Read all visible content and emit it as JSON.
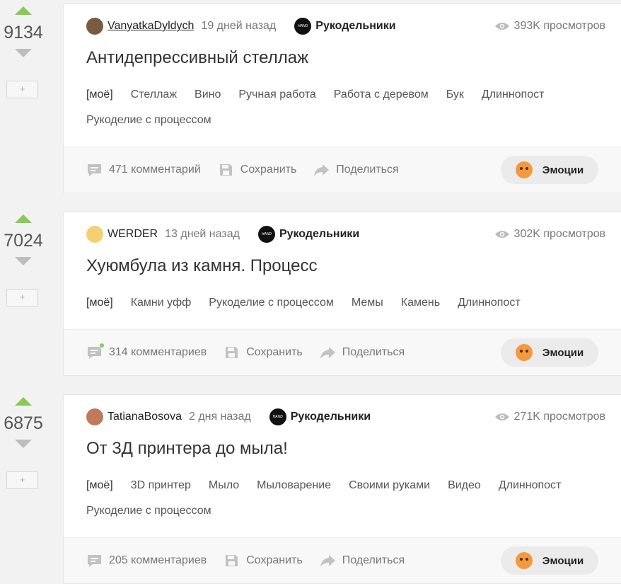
{
  "stories": [
    {
      "score": "9134",
      "author": "VanyatkaDyldych",
      "time": "19 дней назад",
      "community": "Рукодельники",
      "community_logo_text": "HAND MADE",
      "views": "393K просмотров",
      "title": "Антидепрессивный стеллаж",
      "tags": [
        "[моё]",
        "Стеллаж",
        "Вино",
        "Ручная работа",
        "Работа с деревом",
        "Бук",
        "Длиннопост",
        "Рукоделие с процессом"
      ],
      "comments": "471 комментарий",
      "save": "Сохранить",
      "share": "Поделиться",
      "emotions": "Эмоции",
      "avatar_color": "#7a5a40"
    },
    {
      "score": "7024",
      "author": "WERDER",
      "time": "13 дней назад",
      "community": "Рукодельники",
      "community_logo_text": "HAND MADE",
      "views": "302K просмотров",
      "title": "Хуюмбула из камня. Процесс",
      "tags": [
        "[моё]",
        "Камни уфф",
        "Рукоделие с процессом",
        "Мемы",
        "Камень",
        "Длиннопост"
      ],
      "comments": "314 комментариев",
      "save": "Сохранить",
      "share": "Поделиться",
      "emotions": "Эмоции",
      "avatar_color": "#f5d070"
    },
    {
      "score": "6875",
      "author": "TatianaBosova",
      "time": "2 дня назад",
      "community": "Рукодельники",
      "community_logo_text": "HAND MADE",
      "views": "271K просмотров",
      "title": "От 3Д принтера до мыла!",
      "tags": [
        "[моё]",
        "3D принтер",
        "Мыло",
        "Мыловарение",
        "Своими руками",
        "Видео",
        "Длиннопост",
        "Рукоделие с процессом"
      ],
      "comments": "205 комментариев",
      "save": "Сохранить",
      "share": "Поделиться",
      "emotions": "Эмоции",
      "avatar_color": "#c07a5a"
    }
  ],
  "add_button_label": "+",
  "colors": {
    "upvote": "#8ac858",
    "downvote": "#bdbdbd",
    "emotion_face": "#f29a3f"
  }
}
